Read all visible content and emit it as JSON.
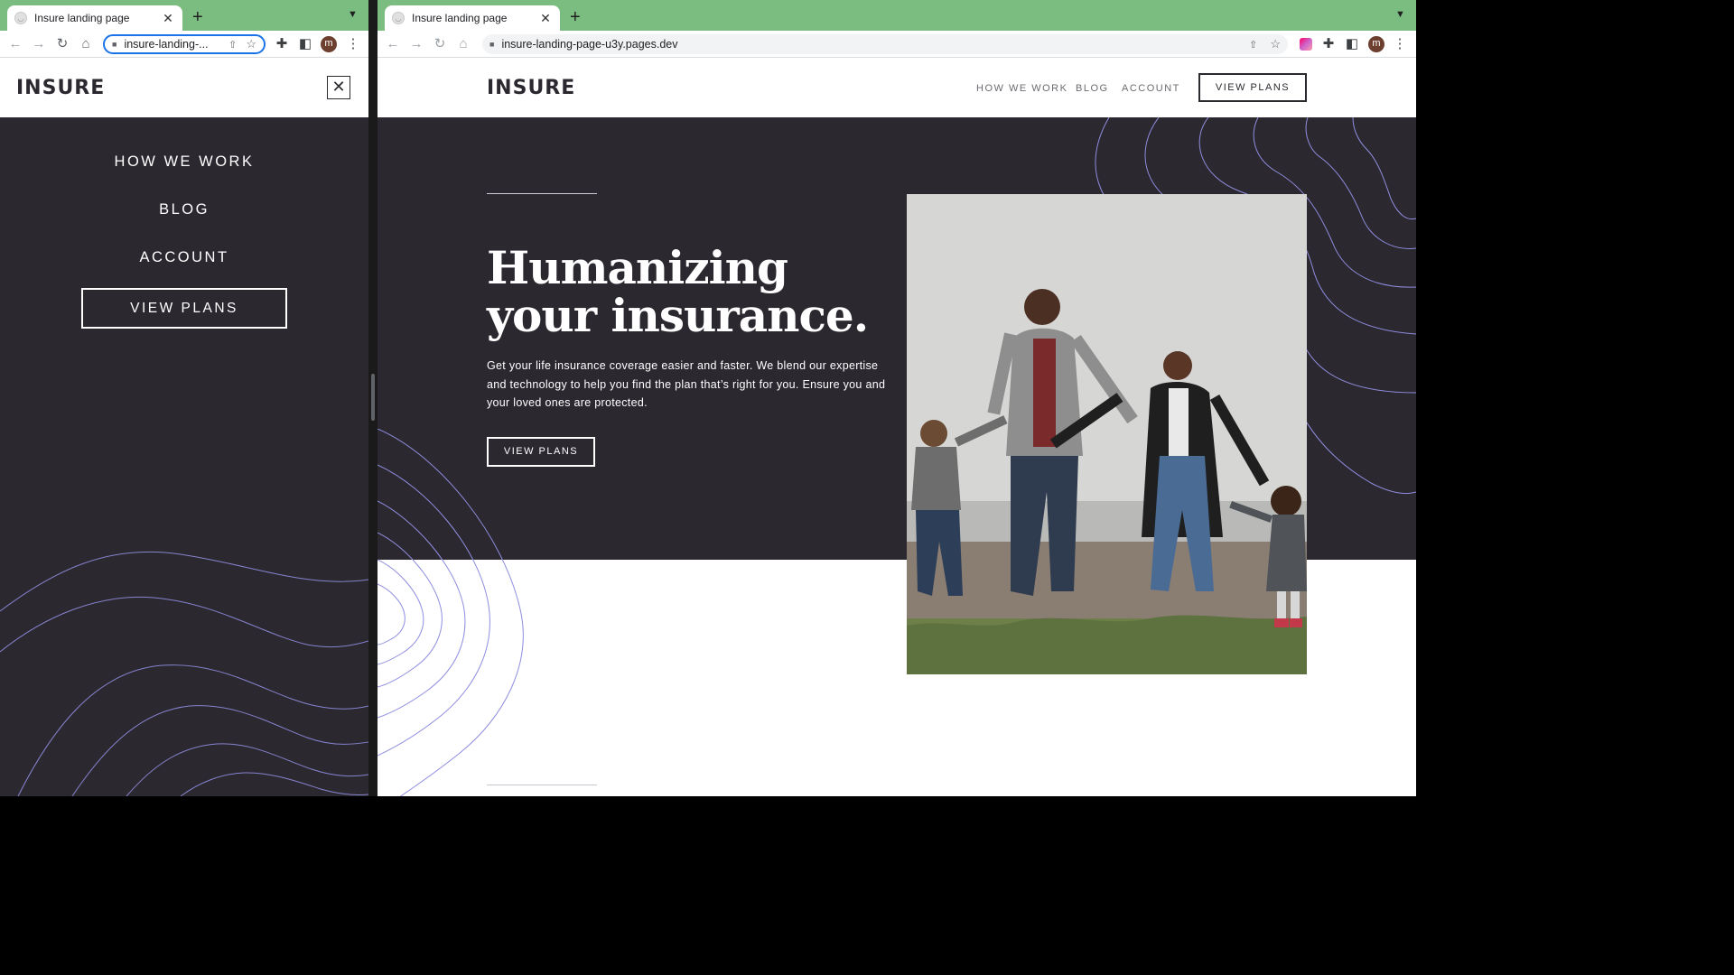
{
  "left_window": {
    "tab_title": "Insure landing page",
    "url": "insure-landing-...",
    "profile_initial": "m",
    "site": {
      "logo": "INSURE",
      "close_glyph": "✕",
      "menu": [
        "HOW WE WORK",
        "BLOG",
        "ACCOUNT"
      ],
      "cta": "VIEW PLANS"
    }
  },
  "right_window": {
    "tab_title": "Insure landing page",
    "url": "insure-landing-page-u3y.pages.dev",
    "profile_initial": "m",
    "site": {
      "logo": "INSURE",
      "nav": [
        "HOW WE WORK",
        "BLOG",
        "ACCOUNT"
      ],
      "nav_cta": "VIEW PLANS",
      "hero": {
        "title_line1": "Humanizing",
        "title_line2": "your insurance.",
        "description": "Get your life insurance coverage easier and faster. We blend our expertise and technology to help you find the plan that’s right for you. Ensure you and your loved ones are protected.",
        "cta": "VIEW PLANS"
      }
    }
  },
  "colors": {
    "tabstrip": "#7bbd80",
    "dark_violet": "#2c2830",
    "pattern_line": "#8f8ee0",
    "focus_ring": "#1a73e8"
  },
  "icons": {
    "toolbar": [
      "back-arrow-icon",
      "forward-arrow-icon",
      "reload-icon",
      "home-icon",
      "lock-icon",
      "share-icon",
      "star-icon",
      "extensions-puzzle-icon",
      "side-panel-icon",
      "kebab-menu-icon"
    ]
  }
}
